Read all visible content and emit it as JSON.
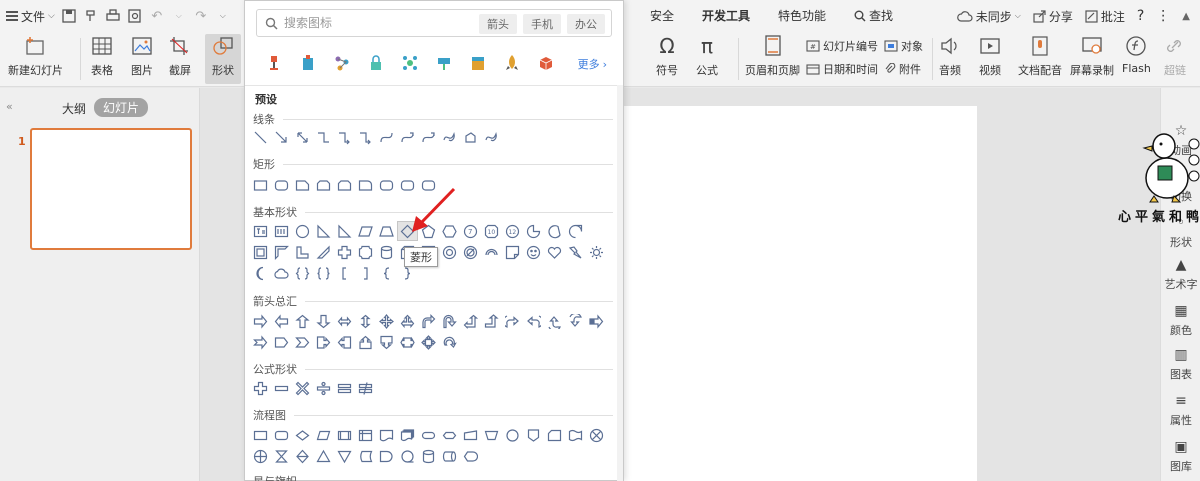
{
  "menubar": {
    "file_label": "文件",
    "tabs": [
      "安全",
      "开发工具",
      "特色功能"
    ],
    "search_label": "查找",
    "sync_label": "未同步",
    "share_label": "分享",
    "comment_label": "批注",
    "help": "?",
    "more": "⋮"
  },
  "ribbon": {
    "new_slide": "新建幻灯片",
    "table": "表格",
    "picture": "图片",
    "screenshot": "截屏",
    "shape": "形状",
    "symbol": "符号",
    "formula": "公式",
    "header_footer": "页眉和页脚",
    "slide_number": "幻灯片编号",
    "object": "对象",
    "date_time": "日期和时间",
    "attachment": "附件",
    "audio": "音频",
    "video": "视频",
    "voiceover": "文档配音",
    "screen_record": "屏幕录制",
    "flash": "Flash",
    "hyperlink": "超链"
  },
  "left_panel": {
    "tab_outline": "大纲",
    "tab_slides": "幻灯片",
    "slide_number": "1"
  },
  "sidebar": {
    "items": [
      {
        "label": "动画",
        "icon": "star-icon"
      },
      {
        "label": "切换",
        "icon": "transition-icon"
      },
      {
        "label": "形状",
        "icon": "shape-icon"
      },
      {
        "label": "艺术字",
        "icon": "wordart-icon"
      },
      {
        "label": "颜色",
        "icon": "palette-icon"
      },
      {
        "label": "图表",
        "icon": "chart-icon"
      },
      {
        "label": "属性",
        "icon": "sliders-icon"
      },
      {
        "label": "图库",
        "icon": "gallery-icon"
      }
    ]
  },
  "watermark": "心平氣和鸭",
  "shape_panel": {
    "search_placeholder": "搜索图标",
    "tags": [
      "箭头",
      "手机",
      "办公"
    ],
    "more_label": "更多",
    "preset_label": "预设",
    "categories": [
      "线条",
      "矩形",
      "基本形状",
      "箭头总汇",
      "公式形状",
      "流程图",
      "星与旗帜"
    ],
    "tooltip": "菱形",
    "hovered_shape": "diamond-shape"
  },
  "colors": {
    "accent_orange": "#e07b3c",
    "shape_stroke": "#5b6f94",
    "link_blue": "#3d7ddd",
    "arrow_red": "#e02020"
  }
}
